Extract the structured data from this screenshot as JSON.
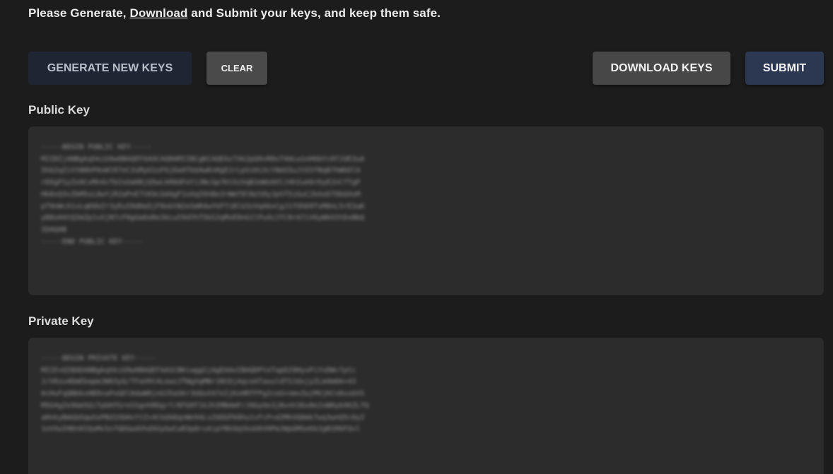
{
  "instruction": {
    "prefix": "Please Generate, ",
    "link": "Download",
    "suffix": " and Submit your keys, and keep them safe."
  },
  "toolbar": {
    "generate_label": "GENERATE NEW KEYS",
    "clear_label": "CLEAR",
    "download_label": "DOWNLOAD KEYS",
    "submit_label": "SUBMIT"
  },
  "public_key": {
    "label": "Public Key",
    "value": "-----BEGIN PUBLIC KEY-----\nMIIBIjANBgkqhkiG9w0BAQEFAAOCAQ8AMIIBCgKCAQEAz7Xk2pQ9vR8sT4mLw1nH6bYc0fJdE3uA\n5hG2qZiVtN8kP0xWlR7eC3sMyU1oF6jDa9TbQ4wKnHgE2rLpVz0iXcY8mS5uJtO3fNqB7hWkDlA\nrE6gP1yZo9CxMn4vTb2sUaH8jQ5wLkR0dFeYi3NcGp7KtXzVqB1mWs6OlJ4hIuA9rDyE2nCfTgP\nHk8xQ3vZbM5sL0wYjR2aPnE7tK9cUd4gF1oXqI6hBe3rWmT8lNzS0yJpVf5iGuC2kAxD7ObQ4sM\npT9nWcX1vLqK6bZr3yEuI0dHa5jF8oGtN2eSmR4wYkP7iBlU3zVqA6xCgJ1fOhD9TsM0nL5rE2wK\nyB8sH4tQ2mZp1vXjN7cF0gUa6oRe3kLwI9dYhT5bS2qMxE8nG1lPu4zJfC0rA7iV6yWkO3tDsNbQ\nIDAQAB\n-----END PUBLIC KEY-----"
  },
  "private_key": {
    "label": "Private Key",
    "value": "-----BEGIN PRIVATE KEY-----\nMIIEvQIBADANBgkqhkiG9w0BAQEFAASCBKcwggSjAgEAAoIBAQDPteTapD29HyxPiYvDWcfptc\nJ/V0zu4DmEbapmJW03yQ/TFaVHt4LewzJTWgXqMNr1NtDjAqceATasuldTSJdxjyZLm4m0A+43\n0cHuFqQNbkxHB9vaPxGDl8dwW0jnUJ5aSKr3UQsX47eIjKxHRTFPg2ceG+nmvZwjMVjKCn8sxbVS\nM5G4gZe9Gm5QiTpbHfGreSSgnhRDgrf/NTQ9T1kJhIMN4mP/J9GyOe3jBvnh36x8e2xW0ybXKZLTQ\naHnkyBmGbOqwSoPBd1XbHxYtZ+4CGdA8qnWe94LsZdOGFK0hu1vFcP+d2MhVQ0mk7wq3wnQ5c0yZ\n1oVXwIHDn0IQoMvSn7QDGwdVhdXUyGwCwEOp8ru4ipYNVdqVkoU6VHPmJWpGMSe6k2gN1R6FQvl"
  }
}
